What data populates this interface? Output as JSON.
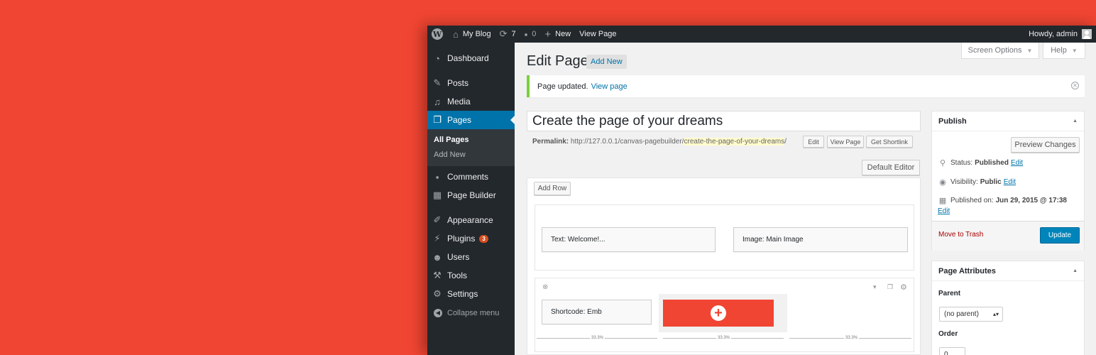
{
  "admin_bar": {
    "site_name": "My Blog",
    "updates_count": "7",
    "comments_count": "0",
    "new_label": "New",
    "view_page_label": "View Page",
    "howdy": "Howdy, admin"
  },
  "sidebar": {
    "items": [
      {
        "label": "Dashboard",
        "icon": "dashboard-icon"
      },
      {
        "label": "Posts",
        "icon": "pin-icon"
      },
      {
        "label": "Media",
        "icon": "media-icon"
      },
      {
        "label": "Pages",
        "icon": "pages-icon"
      },
      {
        "label": "Comments",
        "icon": "comment-icon"
      },
      {
        "label": "Page Builder",
        "icon": "grid-icon"
      },
      {
        "label": "Appearance",
        "icon": "brush-icon"
      },
      {
        "label": "Plugins",
        "icon": "plug-icon",
        "badge": "3"
      },
      {
        "label": "Users",
        "icon": "user-icon"
      },
      {
        "label": "Tools",
        "icon": "wrench-icon"
      },
      {
        "label": "Settings",
        "icon": "settings-icon"
      }
    ],
    "submenu": [
      "All Pages",
      "Add New"
    ],
    "collapse_label": "Collapse menu"
  },
  "screen_tabs": {
    "screen_options": "Screen Options",
    "help": "Help"
  },
  "page": {
    "heading": "Edit Page",
    "add_new": "Add New",
    "notice_text": "Page updated.",
    "notice_link": "View page",
    "title_value": "Create the page of your dreams",
    "permalink_label": "Permalink:",
    "permalink_base": "http://127.0.0.1/canvas-pagebuilder/",
    "permalink_slug": "create-the-page-of-your-dreams",
    "permalink_end": "/",
    "btn_edit": "Edit",
    "btn_view_page": "View Page",
    "btn_shortlink": "Get Shortlink",
    "default_editor": "Default Editor"
  },
  "builder": {
    "add_row": "Add Row",
    "row1_widgets": [
      "Text: Welcome!...",
      "Image: Main Image"
    ],
    "row2_widget": "Shortcode: Emb",
    "cell_width": "33.3%"
  },
  "publish": {
    "title": "Publish",
    "preview": "Preview Changes",
    "status_label": "Status:",
    "status_value": "Published",
    "visibility_label": "Visibility:",
    "visibility_value": "Public",
    "published_label": "Published on:",
    "published_value": "Jun 29, 2015 @ 17:38",
    "edit": "Edit",
    "trash": "Move to Trash",
    "update": "Update"
  },
  "attributes": {
    "title": "Page Attributes",
    "parent_label": "Parent",
    "parent_value": "(no parent)",
    "order_label": "Order",
    "order_value": "0"
  },
  "colors": {
    "background": "#f04532",
    "admin_bar": "#23282d",
    "active_menu": "#0073aa",
    "update_button": "#0085ba",
    "notice_border": "#7ad03a"
  }
}
